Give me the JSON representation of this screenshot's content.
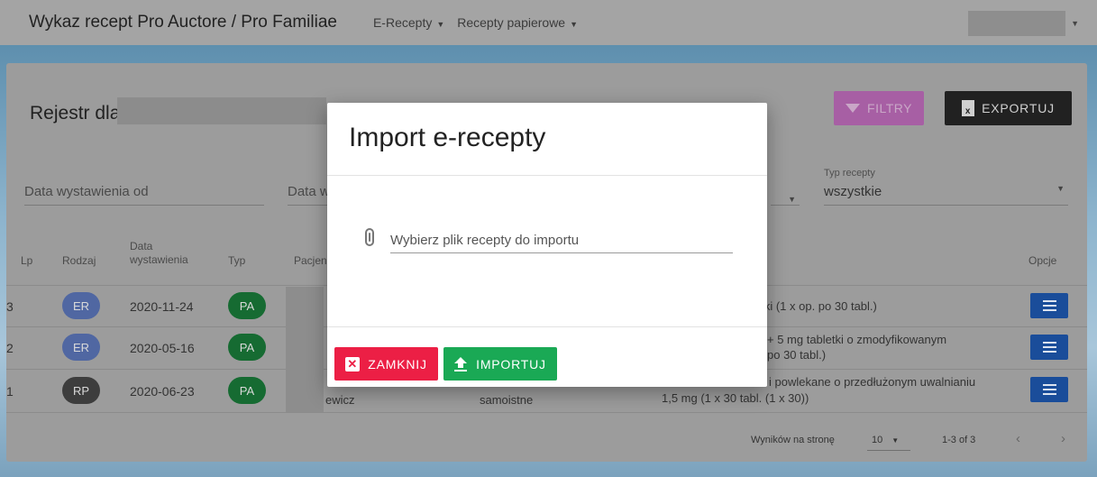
{
  "header": {
    "title": "Wykaz recept Pro Auctore / Pro Familiae",
    "menu": [
      {
        "label": "E-Recepty"
      },
      {
        "label": "Recepty papierowe"
      }
    ]
  },
  "toolbar": {
    "registry_label": "Rejestr dla:",
    "filter_label": "FILTRY",
    "export_label": "EXPORTUJ"
  },
  "filters": {
    "date_from_label": "Data wystawienia od",
    "date_to_label": "Data w",
    "type_label": "Typ recepty",
    "type_value": "wszystkie"
  },
  "table": {
    "columns": {
      "lp": "Lp",
      "kind": "Rodzaj",
      "date": "Data wystawienia",
      "type": "Typ",
      "patient": "Pacjen",
      "options": "Opcje"
    },
    "rows": [
      {
        "lp": "3",
        "kind": "ER",
        "date": "2020-11-24",
        "type": "PA",
        "drug": "etki (1 x op. po 30 tabl.)",
        "drug2": ""
      },
      {
        "lp": "2",
        "kind": "ER",
        "date": "2020-05-16",
        "type": "PA",
        "drug": "+ 5 mg tabletki o zmodyfikowanym",
        "drug2": "po 30 tabl.)"
      },
      {
        "lp": "1",
        "kind": "RP",
        "date": "2020-06-23",
        "type": "PA",
        "patient_tail": "ewicz",
        "status": "samoistne",
        "drug": "i powlekane o przedłużonym uwalnianiu",
        "drug2": "1,5 mg (1 x 30 tabl. (1 x 30))"
      }
    ]
  },
  "footer": {
    "per_page_label": "Wyników na stronę",
    "per_page_value": "10",
    "range": "1-3 of 3"
  },
  "modal": {
    "title": "Import e-recepty",
    "file_placeholder": "Wybierz plik recepty do importu",
    "close_label": "ZAMKNIJ",
    "import_label": "IMPORTUJ"
  },
  "colors": {
    "filter_button": "#a75fa4",
    "export_button": "#212121",
    "close_button": "#ec1f45",
    "import_button": "#1aa955",
    "options_button": "#1a4d9a"
  }
}
